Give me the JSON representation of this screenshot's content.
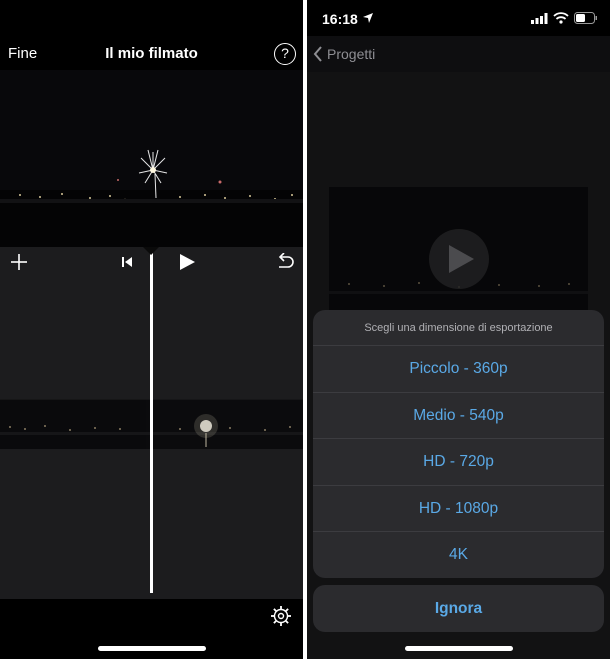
{
  "left": {
    "header": {
      "done_label": "Fine",
      "title": "Il mio filmato",
      "help_label": "?"
    },
    "icons": {
      "add": "plus-icon",
      "skip_back": "skip-back-icon",
      "play": "play-icon",
      "undo": "undo-icon",
      "settings": "gear-icon",
      "help": "question-circle-icon"
    }
  },
  "right": {
    "status_bar": {
      "time": "16:18"
    },
    "nav": {
      "back_label": "Progetti"
    },
    "export_sheet": {
      "title": "Scegli una dimensione di esportazione",
      "options": [
        {
          "label": "Piccolo - 360p"
        },
        {
          "label": "Medio - 540p"
        },
        {
          "label": "HD - 720p"
        },
        {
          "label": "HD - 1080p"
        },
        {
          "label": "4K"
        }
      ],
      "cancel_label": "Ignora"
    }
  },
  "colors": {
    "accent": "#5aa9e6",
    "sheet_bg": "#2b2b2e",
    "bg_dark": "#1c1c1e"
  }
}
